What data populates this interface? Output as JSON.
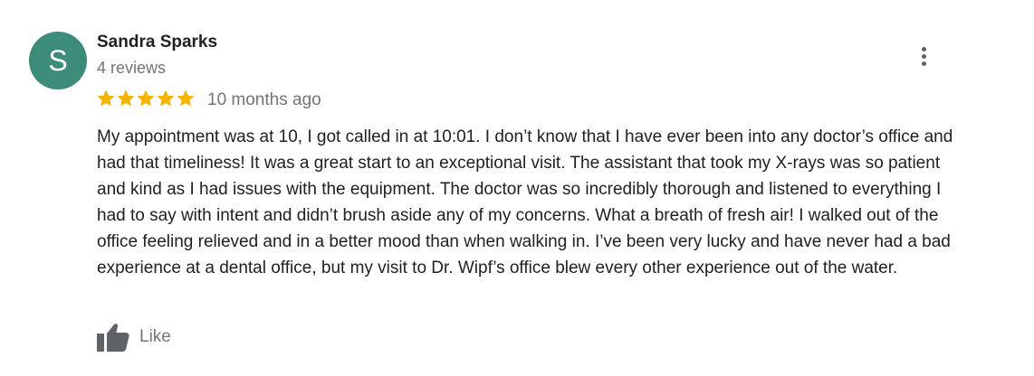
{
  "review": {
    "avatar_letter": "S",
    "avatar_color": "#3d8b79",
    "reviewer_name": "Sandra Sparks",
    "reviewer_review_count": "4 reviews",
    "rating": 5,
    "rating_max": 5,
    "star_color": "#f4b400",
    "date": "10 months ago",
    "text": "My appointment was at 10, I got called in at 10:01. I don’t know that I have ever been into any doctor’s office and had that timeliness! It was a great start to an exceptional visit. The assistant that took my X-rays was so patient and kind as I had issues with the equipment. The doctor was so incredibly thorough and listened to everything I had to say with intent and didn’t brush aside any of my concerns. What a breath of fresh air! I walked out of the office feeling relieved and in a better mood than when walking in. I’ve been very lucky and have never had a bad experience at a dental office, but my visit to Dr. Wipf’s office blew every other experience out of the water.",
    "like_label": "Like",
    "more_icon": "more-vert-icon",
    "like_icon": "thumbs-up-icon"
  }
}
